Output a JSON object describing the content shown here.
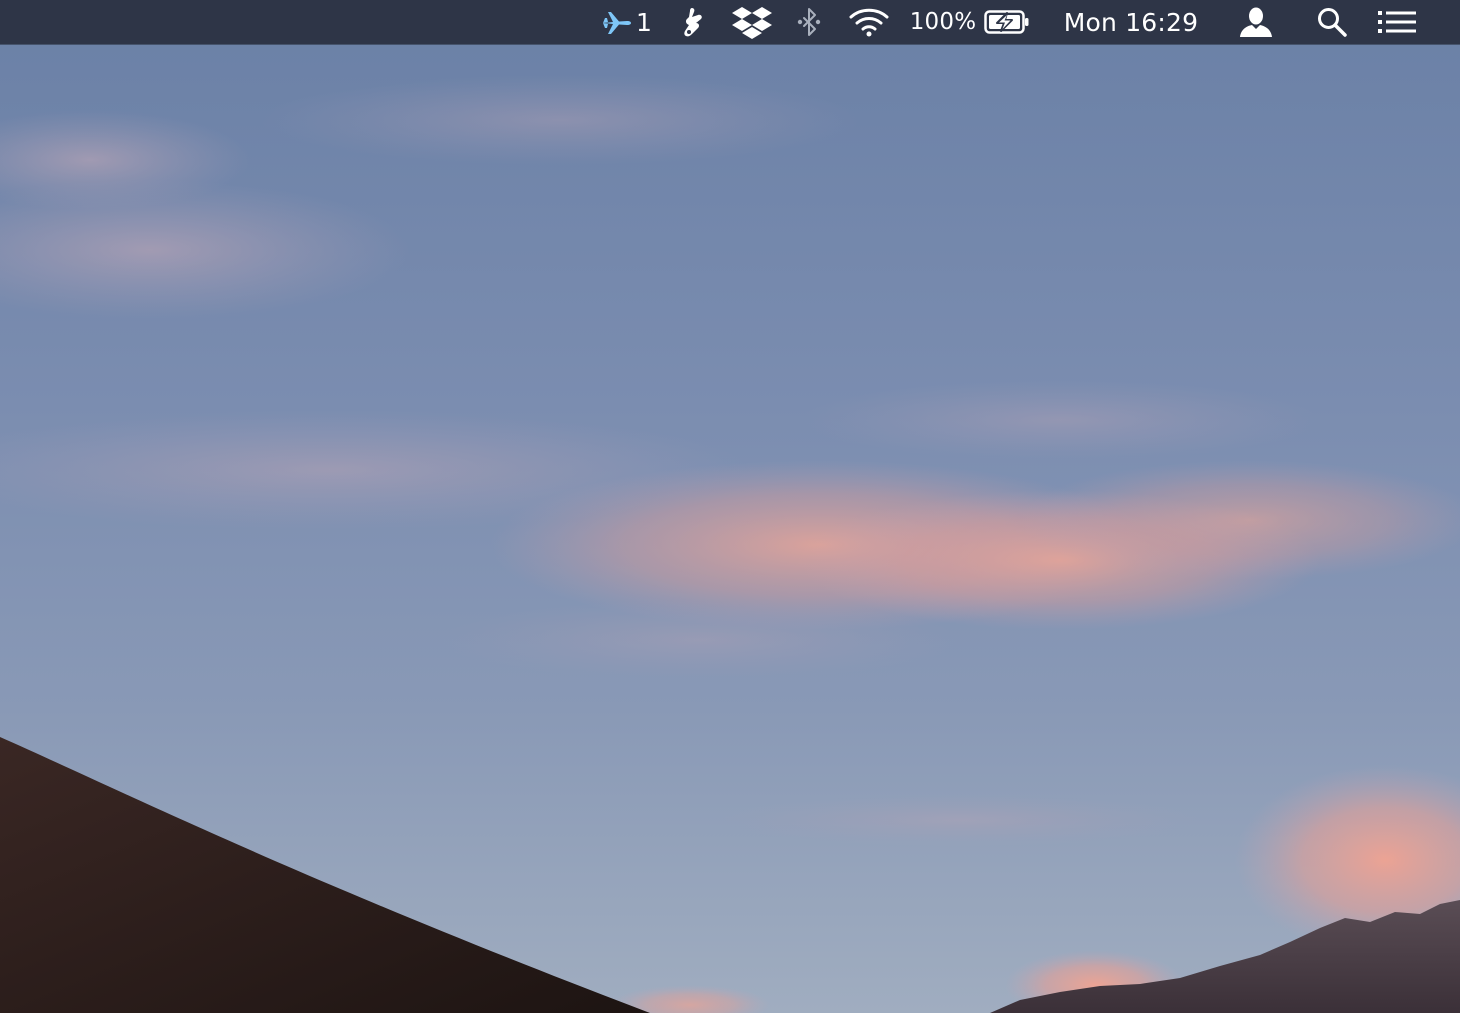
{
  "menubar": {
    "background": "#2e3547",
    "items": {
      "airplane": {
        "icon": "airplane-icon",
        "count": "1",
        "color": "#7ec6f7"
      },
      "hand": {
        "icon": "hand-pointer-icon"
      },
      "dropbox": {
        "icon": "dropbox-icon"
      },
      "bluetooth": {
        "icon": "bluetooth-icon"
      },
      "wifi": {
        "icon": "wifi-icon"
      },
      "battery": {
        "percent": "100%",
        "icon": "battery-charging-icon"
      },
      "clock": {
        "text": "Mon 16:29"
      },
      "user": {
        "icon": "user-icon"
      },
      "spotlight": {
        "icon": "search-icon"
      },
      "notification_center": {
        "icon": "list-icon"
      }
    }
  },
  "wallpaper": {
    "description_colors": {
      "sky_top": "#6f86ab",
      "sky_bottom": "#9fadc1",
      "clouds": "#e9a79a",
      "dune": "#2a1c1a",
      "mountains": "#4a3f48"
    }
  }
}
